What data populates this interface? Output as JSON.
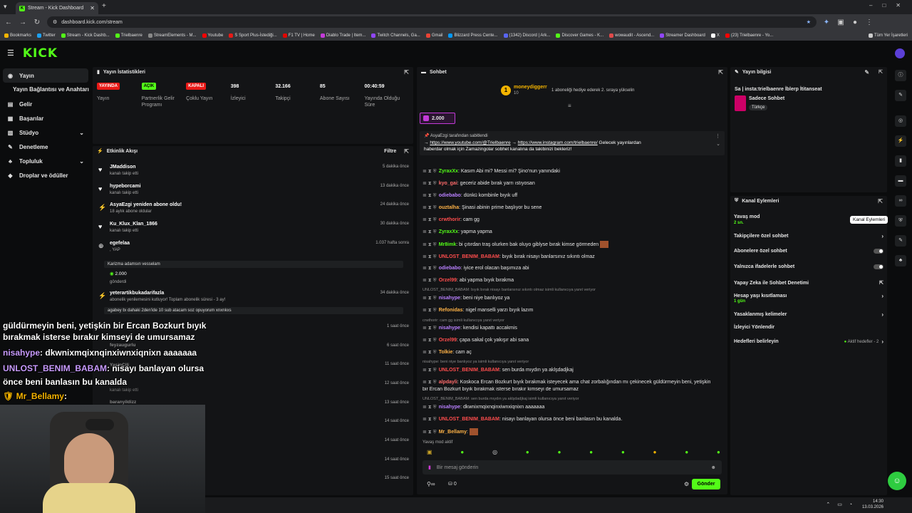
{
  "browser": {
    "tab_title": "Stream - Kick Dashboard",
    "url": "dashboard.kick.com/stream",
    "bookmarks": [
      "Bookmarks",
      "Twitter",
      "Stream - Kick Dashb...",
      "Trielbaenre",
      "StreamElements - M...",
      "Youtube",
      "S Sport Plus-İstediği...",
      "F1 TV | Home",
      "Diablo Trade | Item...",
      "Twitch Channels, Ga...",
      "Gmail",
      "Blizzard Press Cente...",
      "(1342) Discord | Ark...",
      "Discover Games - K...",
      "wowaudit - Ascend...",
      "Streamer Dashboard",
      "X",
      "(23) Trielbaenre - Yo...",
      "Tüm Yer İşaretleri"
    ]
  },
  "sidebar": {
    "items": [
      {
        "label": "Yayın",
        "icon": "broadcast-icon"
      },
      {
        "label": "Yayın Bağlantısı ve Anahtarı"
      },
      {
        "label": "Gelir",
        "icon": "money-icon"
      },
      {
        "label": "Başarılar",
        "icon": "trophy-icon"
      },
      {
        "label": "Stüdyo",
        "icon": "studio-icon"
      },
      {
        "label": "Denetleme",
        "icon": "gavel-icon"
      },
      {
        "label": "Topluluk",
        "icon": "community-icon"
      },
      {
        "label": "Droplar ve ödüller",
        "icon": "drops-icon"
      }
    ]
  },
  "stats": {
    "title": "Yayın İstatistikleri",
    "items": [
      {
        "value": "YAYINDA",
        "label": "Yayın",
        "kind": "red"
      },
      {
        "value": "AÇIK",
        "label": "Partnerlik Gelir Programı",
        "kind": "green"
      },
      {
        "value": "KAPALI",
        "label": "Çoklu Yayın",
        "kind": "red"
      },
      {
        "value": "398",
        "label": "İzleyici"
      },
      {
        "value": "32.166",
        "label": "Takipçi"
      },
      {
        "value": "85",
        "label": "Abone Sayısı"
      },
      {
        "value": "00:40:59",
        "label": "Yayında Olduğu Süre"
      }
    ]
  },
  "activity": {
    "title": "Etkinlik Akışı",
    "filter": "Filtre",
    "events": [
      {
        "name": "JMaddison",
        "sub": "kanalı takip etti",
        "time": "5 dakika önce"
      },
      {
        "name": "hypeborcami",
        "sub": "kanalı takip etti",
        "time": "13 dakika önce"
      },
      {
        "name": "AsyaEzgi yeniden abone oldu!",
        "sub": "18 aylık abone oldular",
        "time": "24 dakika önce"
      },
      {
        "name": "Ku_Klux_Klan_1866",
        "sub": "kanalı takip etti",
        "time": "30 dakika önce"
      },
      {
        "name": "egefelaa",
        "sub": ", YAP",
        "time": "1.037 hafta sonra"
      },
      {
        "name": "yeterartikbukadarifazla",
        "sub": "abonelik yenilemesini kutluyor! Toplam abonelik süresi - 3 ay!",
        "time": "34 dakika önce"
      }
    ],
    "egefelaa_quote": "Karizma adamsın vesselam",
    "egefelaa_amount": "2.000",
    "egefelaa_sent": "gönderdi",
    "yeterartik_quote": "agabey bı dahaki 2den'ide 10 sub atacam soz opuyorum xnxnkxs",
    "more_times": [
      "1 saat önce",
      "6 saat önce",
      "11 saat önce",
      "12 saat önce",
      "13 saat önce",
      "14 saat önce",
      "14 saat önce",
      "14 saat önce",
      "15 saat önce"
    ],
    "faded_names": [
      "feyzaugurlu",
      "YasinÇili",
      "ibawet",
      "baranyildizz"
    ],
    "faded_sub": "kanalı takip etti"
  },
  "chat": {
    "title": "Sohbet",
    "top_user": "moneydiggerr",
    "top_user_count": "10",
    "gift_text": "1 aboneliği hediye ederek 2. sıraya yükselin",
    "pinned_amount": "2.000",
    "pinned_by": "AsyaEzgi tarafından sabitlendi",
    "pinned_link1": "https://www.youtube.com/@Trielbaenre",
    "pinned_link2": "https://www.instagram.com/trielbaenre/",
    "pinned_text_a": "Gelecek yayınlardan",
    "pinned_text_b": "haberdar olmak için Zamazingolar sobhet kanalına da takibinizi bekleriz!",
    "messages": [
      {
        "u": "ZyraxXx",
        "c": "#53fc18",
        "t": "Kasım Abi mi? Messi mi? Şino'nun yanındaki"
      },
      {
        "u": "kyo_gai",
        "c": "#ff6b6b",
        "t": "geceriz abide bırak yarrı ıstıyosan"
      },
      {
        "u": "odiebabo",
        "c": "#b980ff",
        "t": "dünkü kombinle bıyık uff"
      },
      {
        "u": "ouztalha",
        "c": "#ffb347",
        "t": "Şinasi abinin prime başlıyor bu sene"
      },
      {
        "u": "crwthorir",
        "c": "#ff4d4d",
        "t": "cam gg"
      },
      {
        "u": "ZyraxXx",
        "c": "#53fc18",
        "t": "yapma yapma"
      },
      {
        "u": "Mr8imk",
        "c": "#53fc18",
        "t": "bi çıtırdan traş olurken bak oluyo giblyse bırak kimse görmeden"
      },
      {
        "u": "UNLOST_BENIM_BABAM",
        "c": "#ff4d4d",
        "t": "bıyık bırak nisayı banlarsınız sıkıntı olmaz"
      },
      {
        "u": "odiebabo",
        "c": "#b980ff",
        "t": "iyice erol olacan başımıza abi"
      },
      {
        "u": "Orzel99",
        "c": "#ff4d4d",
        "t": "abi yapma bıyık bırakma"
      },
      {
        "u": "nisahype",
        "c": "#b980ff",
        "t": "beni niye banlıyoz ya"
      },
      {
        "u": "Refonidas",
        "c": "#ffb347",
        "t": "nigel manselli yarzı bıyık lazım"
      },
      {
        "u": "nisahype",
        "c": "#b980ff",
        "t": "kendisi kapattı accakmis"
      },
      {
        "u": "Orzel99",
        "c": "#ff4d4d",
        "t": "çapa sakal çok yakışır abi sana"
      },
      {
        "u": "Tolkie",
        "c": "#ffb347",
        "t": "cam aç"
      },
      {
        "u": "UNLOST_BENIM_BABAM",
        "c": "#ff4d4d",
        "t": "sen burda mıydın ya aklşdadjkaj"
      },
      {
        "u": "alpdayli",
        "c": "#ff6b6b",
        "t": "Koskoca Ercan Bozkurt bıyık bırakmak isteyecek ama chat zorbalığından mı çekinecek güldürmeyin beni, yetişkin"
      },
      {
        "u": "nisahype",
        "c": "#b980ff",
        "t": "dkwnixmqixnqinxiwnxiqnixn aaaaaaa"
      },
      {
        "u": "UNLOST_BENIM_BABAM",
        "c": "#ff4d4d",
        "t": "nisayı banlayan olursa önce beni banlasın bu kanalda."
      },
      {
        "u": "Mr_Bellamy",
        "c": "#ffb347",
        "t": ""
      }
    ],
    "replies": [
      "UNLOST_BENIM_BABAM: bıyık bırak nisayı banlarsınız sıkıntı olmaz isimli kullanıcıya yanıt veriyor",
      "crwthorir: cam gg isimli kullanıcıya yanıt veriyor",
      "nisahype: beni niye banlıyoz ya isimli kullanıcıya yanıt veriyor",
      "UNLOST_BENIM_BABAM: sen burda mıydın ya aklşdadjkaj isimli kullanıcıya yanıt veriyor"
    ],
    "alpdayli_line2": "bir Ercan Bozkurt bıyık bırakmak isterse bırakır kimseyi de umursamaz",
    "slow_mode": "Yavaş mod aktif",
    "input_placeholder": "Bir mesaj gönderin",
    "send": "Gönder",
    "points": "0"
  },
  "streaminfo": {
    "title": "Yayın bilgisi",
    "stream_title": "Sa | insta:trielbaenre İblerp İtitanseat",
    "category": "Sadece Sohbet",
    "language": "Türkçe"
  },
  "channel_actions": {
    "title": "Kanal Eylemleri",
    "tooltip": "Kanal Eylemleri",
    "slow_mode": "Yavaş mod",
    "slow_mode_sub": "2 sn.",
    "followers_chat": "Takipçilere özel sohbet",
    "subs_chat": "Abonelere özel sohbet",
    "emote_chat": "Yalnızca ifadelerle sohbet",
    "ai_mod": "Yapay Zeka ile Sohbet Denetimi",
    "account_age": "Hesap yaşı kısıtlaması",
    "account_age_sub": "1 gün",
    "banned_words": "Yasaklanmış kelimeler",
    "viewer_redirect": "İzleyici Yönlendir",
    "goals": "Hedefleri belirleyin",
    "goals_sub": "Aktif hedefler - 2"
  },
  "overlay": {
    "lines": [
      "güldürmeyin beni, yetişkin bir Ercan Bozkurt bıyık",
      "bırakmak isterse bırakır kimseyi de umursamaz"
    ],
    "l3_user": "nisahype",
    "l3_text": ": dkwnixmqixnqinxiwnxiqnixn aaaaaaa",
    "l4_user": "UNLOST_BENIM_BABAM",
    "l4_text": ": nisayı banlayan olursa",
    "l5": "önce beni banlasın bu kanalda",
    "l6_user": "Mr_Bellamy",
    "l6_text": ":"
  },
  "taskbar": {
    "time": "14:30",
    "date": "13.03.2026"
  }
}
